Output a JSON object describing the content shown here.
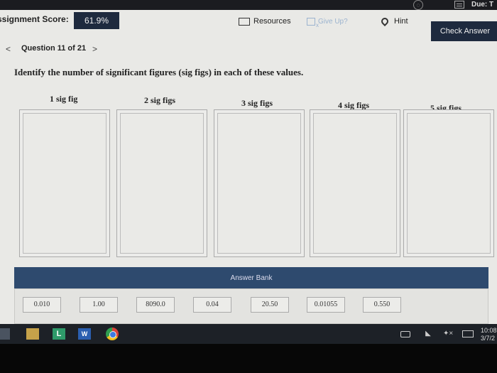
{
  "window": {
    "due_label": "Due: T"
  },
  "header": {
    "score_label": "ssignment Score:",
    "score_value": "61.9%",
    "resources_label": "Resources",
    "give_up_label": "Give Up?",
    "hint_label": "Hint",
    "check_answer_label": "Check Answer"
  },
  "nav": {
    "prev_icon": "chevron-left-icon",
    "next_icon": "chevron-right-icon",
    "question_label": "Question 11 of 21"
  },
  "question": {
    "prompt": "Identify the number of significant figures (sig figs) in each of these values."
  },
  "columns": [
    "1 sig fig",
    "2 sig figs",
    "3 sig figs",
    "4 sig figs",
    "5 sig figs"
  ],
  "answer_bank": {
    "title": "Answer Bank",
    "items": [
      "0.010",
      "1.00",
      "8090.0",
      "0.04",
      "20.50",
      "0.01055",
      "0.550"
    ]
  },
  "taskbar": {
    "apps": [
      "file-explorer-icon",
      "store-icon",
      "l-app-icon",
      "word-icon",
      "chrome-icon"
    ],
    "l_app_glyph": "L",
    "word_glyph": "W",
    "volume_glyph": "✦×",
    "clock_time": "10:08",
    "clock_date": "3/7/2"
  },
  "colors": {
    "accent_dark": "#1e2a3e",
    "bank_header": "#2e4a6e",
    "give_up_disabled": "#9bb3cf"
  }
}
